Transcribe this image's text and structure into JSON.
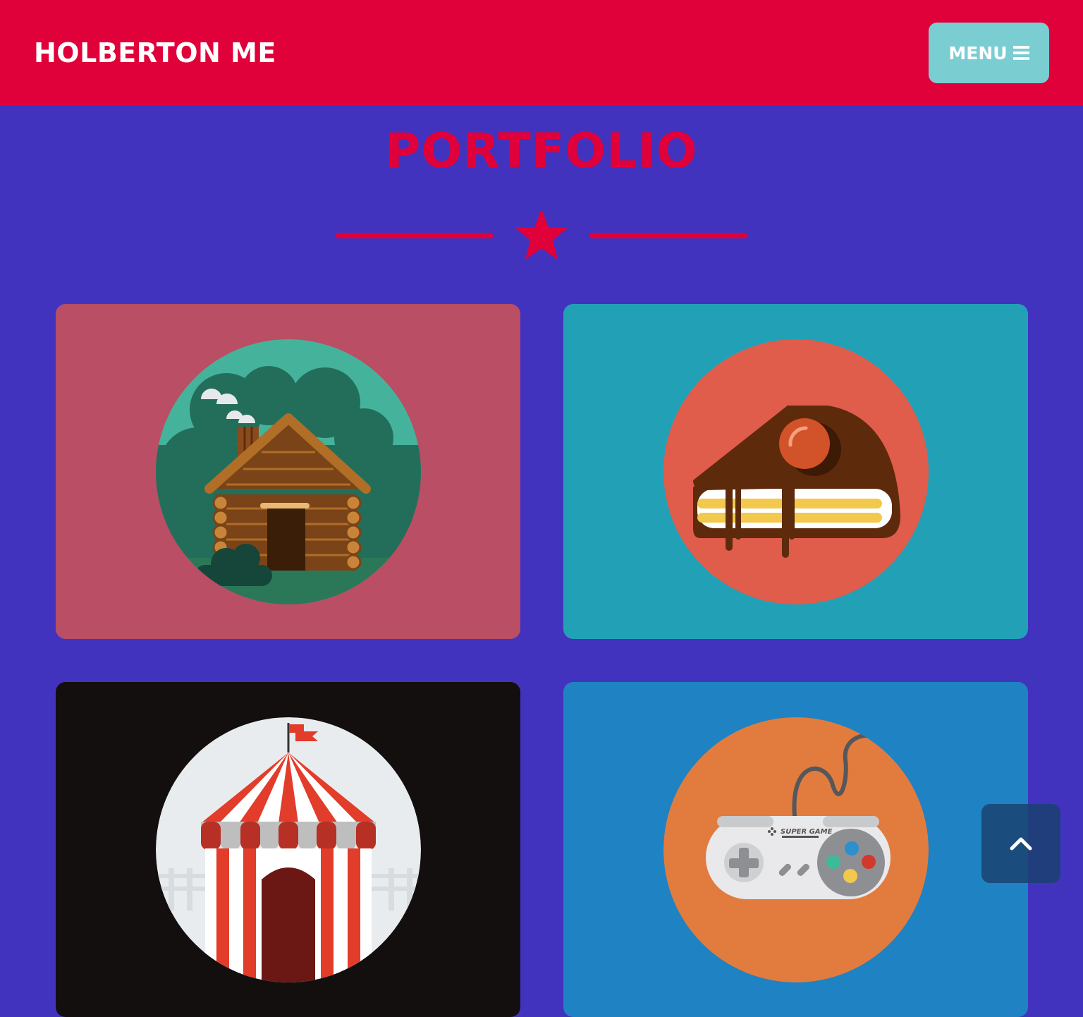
{
  "navbar": {
    "brand": "HOLBERTON ME",
    "menu_label": "MENU",
    "menu_icon": "bars-icon"
  },
  "portfolio": {
    "title": "PORTFOLIO",
    "divider_icon": "star-icon",
    "items": [
      {
        "name": "log-cabin",
        "icon": "cabin-icon",
        "bg": "#B94E64",
        "circle": "#45B39C"
      },
      {
        "name": "cake",
        "icon": "cake-icon",
        "bg": "#22A1B6",
        "circle": "#E05C4B"
      },
      {
        "name": "circus",
        "icon": "circus-tent-icon",
        "bg": "#130F0F",
        "circle": "#E9ECEE"
      },
      {
        "name": "game-controller",
        "icon": "game-controller-icon",
        "bg": "#1F82C2",
        "circle": "#E27C3E",
        "controller_text": "SUPER GAME"
      }
    ]
  },
  "scroll_top": {
    "icon": "chevron-up-icon"
  },
  "colors": {
    "page_bg": "#4233BE",
    "navbar_bg": "#E0003A",
    "accent": "#E0003A",
    "menu_button_bg": "#7ACDD1"
  }
}
